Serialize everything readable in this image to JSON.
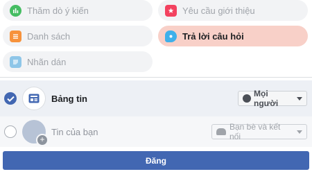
{
  "options": [
    {
      "label": "Thăm dò ý kiến",
      "icon": "poll-icon",
      "color": "#45bd62"
    },
    {
      "label": "Yêu cầu giới thiệu",
      "icon": "recommendation-icon",
      "color": "#f3425f"
    },
    {
      "label": "Danh sách",
      "icon": "list-icon",
      "color": "#f7923b"
    },
    {
      "label": "Trả lời câu hỏi",
      "icon": "answer-icon",
      "color": "#3fb0ea"
    },
    {
      "label": "Nhãn dán",
      "icon": "sticker-icon",
      "color": "#8ec6e8"
    }
  ],
  "audience": {
    "news_feed": {
      "label": "Bảng tin",
      "selector": "Mọi người",
      "checked": true
    },
    "story": {
      "label": "Tin của bạn",
      "selector": "Bạn bè và kết nối",
      "checked": false
    }
  },
  "post_button": "Đăng",
  "colors": {
    "accent": "#4267b2",
    "active_pill": "#f8d0c8"
  }
}
